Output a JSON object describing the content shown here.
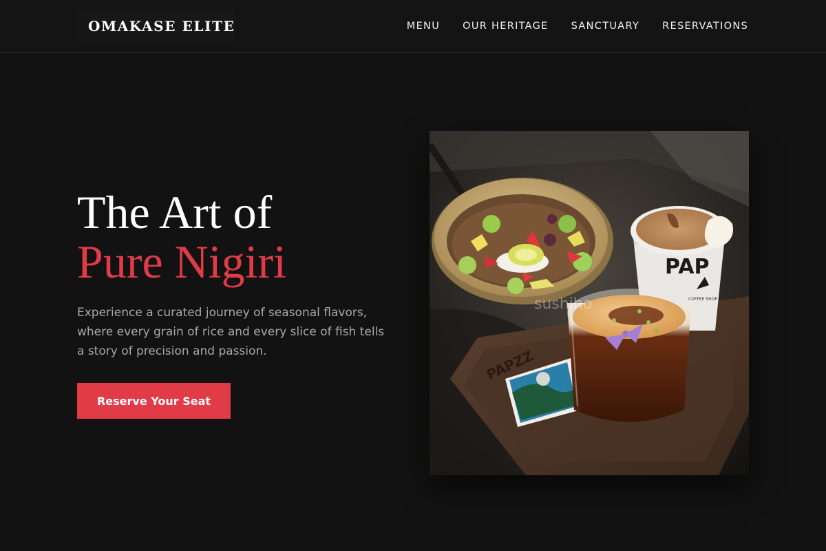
{
  "header": {
    "logo": "OMAKASE ELITE",
    "nav": [
      {
        "label": "MENU"
      },
      {
        "label": "OUR HERITAGE"
      },
      {
        "label": "SANCTUARY"
      },
      {
        "label": "RESERVATIONS"
      }
    ]
  },
  "hero": {
    "title_line1": "The Art of",
    "title_line2": "Pure Nigiri",
    "description": "Experience a curated journey of seasonal flavors, where every grain of rice and every slice of fish tells a story of precision and passion.",
    "cta_label": "Reserve Your Seat"
  },
  "image": {
    "watermark": "sushiho",
    "cup_brand": "PAP",
    "tray_text": "PAPZZ",
    "cup_subtext": "COFFEE SHOP"
  },
  "colors": {
    "background": "#121212",
    "accent": "#e23b48",
    "text": "#ffffff",
    "muted": "#a8a8a8"
  }
}
